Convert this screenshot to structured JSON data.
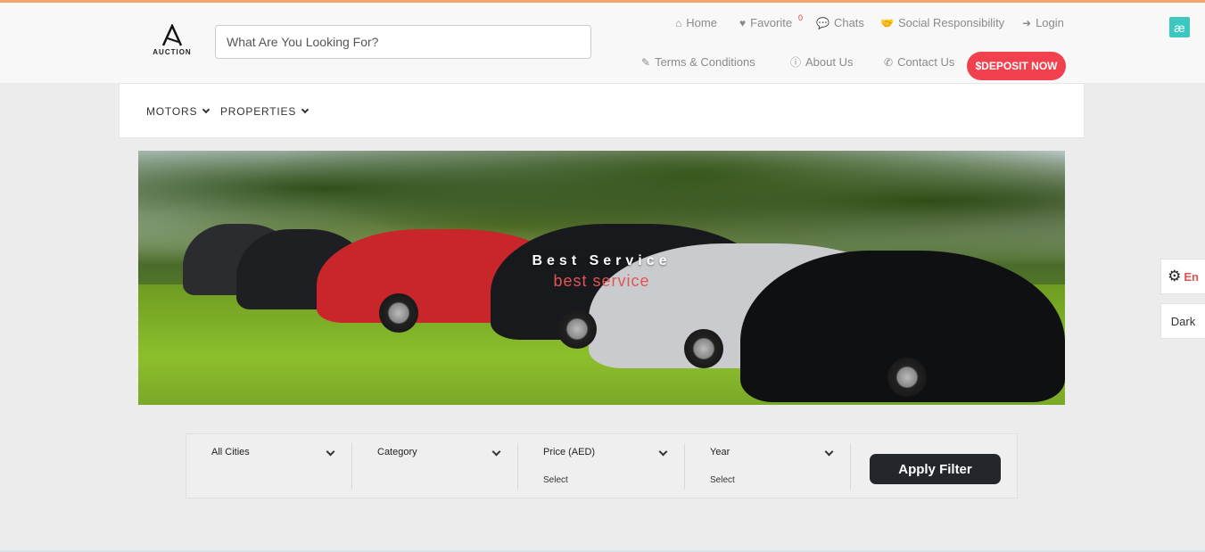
{
  "header": {
    "logo_text": "AUCTION",
    "search_placeholder": "What Are You Looking For?",
    "nav": {
      "home": "Home",
      "favorite": "Favorite",
      "favorite_count": "0",
      "chats": "Chats",
      "social": "Social Responsibility",
      "login": "Login",
      "terms": "Terms & Conditions",
      "about": "About Us",
      "contact": "Contact Us"
    },
    "deposit_label": "$DEPOSIT NOW",
    "ae_badge": "æ"
  },
  "menu": {
    "items": [
      "MOTORS",
      "PROPERTIES"
    ]
  },
  "hero": {
    "title": "Best Service",
    "subtitle": "best service"
  },
  "filters": {
    "cities": {
      "label": "All Cities",
      "value": ""
    },
    "category": {
      "label": "Category",
      "value": ""
    },
    "price": {
      "label": "Price (AED)",
      "value": "Select"
    },
    "year": {
      "label": "Year",
      "value": "Select"
    },
    "apply_label": "Apply Filter"
  },
  "side": {
    "lang": "En",
    "theme": "Dark"
  },
  "colors": {
    "accent": "#f2414e",
    "top_line": "#f0a46c",
    "ae_badge": "#3cc8c0",
    "apply_button": "#23272b"
  }
}
